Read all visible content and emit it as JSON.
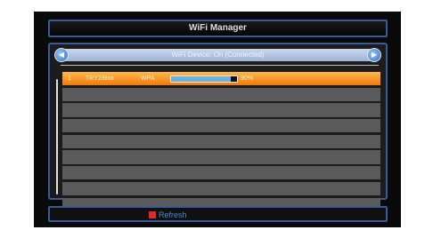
{
  "window": {
    "title": "WiFi Manager"
  },
  "device": {
    "status_text": "WiFi Device: On (Connected)"
  },
  "networks": [
    {
      "index": "1",
      "ssid": "TRY2/Box",
      "security": "WPA",
      "signal_percent": 90,
      "signal_text": "90%"
    }
  ],
  "footer": {
    "refresh_label": "Refresh",
    "refresh_key_color": "#e0281e"
  },
  "colors": {
    "accent": "#3a5a9a",
    "selection": "#f07a0e"
  }
}
